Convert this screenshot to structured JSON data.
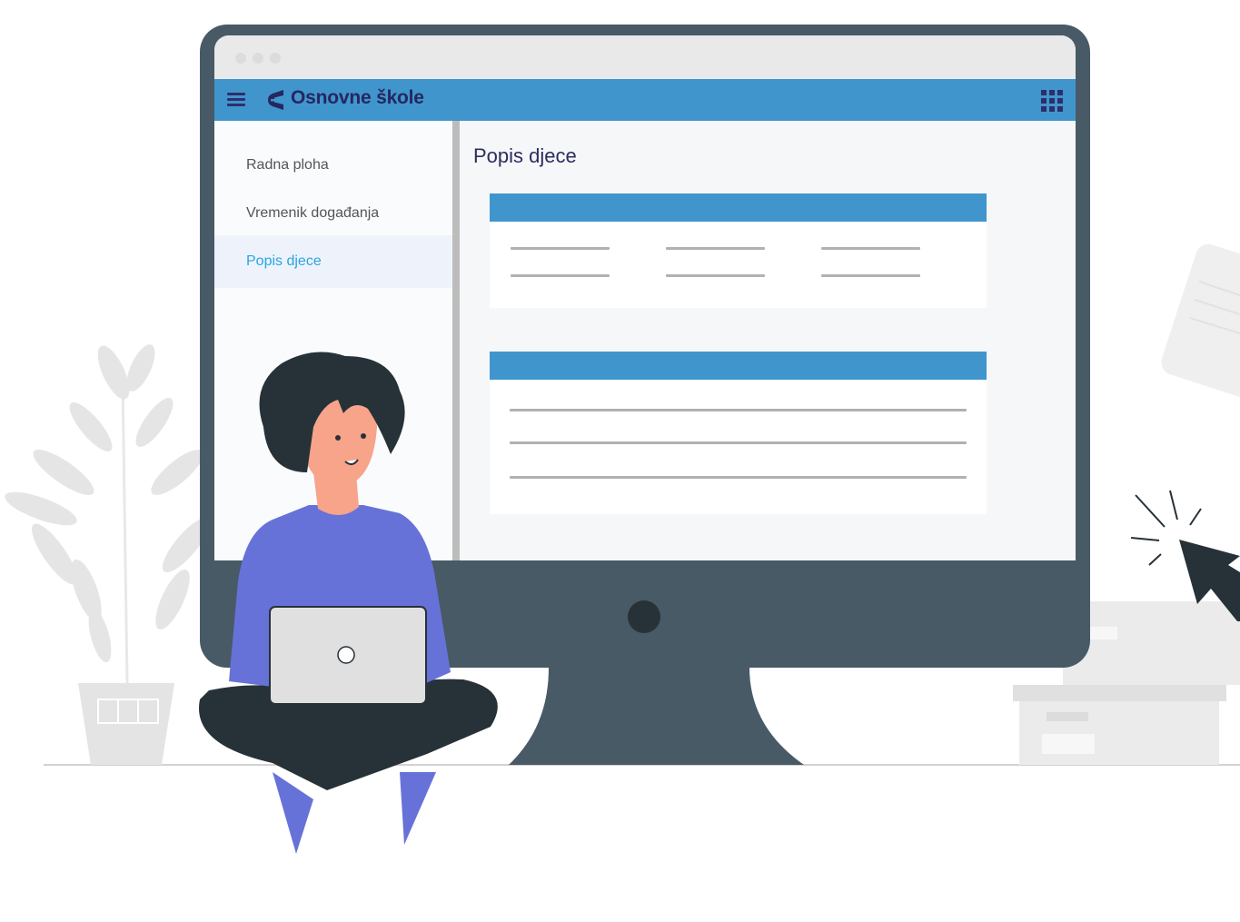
{
  "app": {
    "title": "Osnovne škole"
  },
  "sidebar": {
    "items": [
      {
        "label": "Radna ploha",
        "active": false
      },
      {
        "label": "Vremenik događanja",
        "active": false
      },
      {
        "label": "Popis djece",
        "active": true
      }
    ]
  },
  "main": {
    "page_title": "Popis djece"
  },
  "icons": {
    "menu": "hamburger-menu-icon",
    "logo": "school-logo-icon",
    "apps": "apps-grid-icon"
  },
  "colors": {
    "header": "#4195cd",
    "title_text": "#25275f",
    "active_nav": "#27a5e2",
    "monitor": "#475a66",
    "person_shirt": "#6772d8"
  }
}
